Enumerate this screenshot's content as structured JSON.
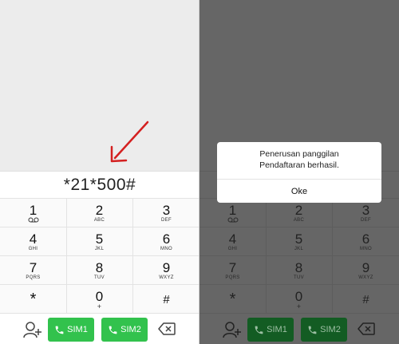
{
  "left": {
    "dialed_number": "*21*500#",
    "keypad": [
      [
        {
          "digit": "1",
          "letters": "○○"
        },
        {
          "digit": "2",
          "letters": "ABC"
        },
        {
          "digit": "3",
          "letters": "DEF"
        }
      ],
      [
        {
          "digit": "4",
          "letters": "GHI"
        },
        {
          "digit": "5",
          "letters": "JKL"
        },
        {
          "digit": "6",
          "letters": "MNO"
        }
      ],
      [
        {
          "digit": "7",
          "letters": "PQRS"
        },
        {
          "digit": "8",
          "letters": "TUV"
        },
        {
          "digit": "9",
          "letters": "WXYZ"
        }
      ],
      [
        {
          "digit": "*",
          "letters": ""
        },
        {
          "digit": "0",
          "letters": "+"
        },
        {
          "digit": "#",
          "letters": ""
        }
      ]
    ],
    "sim1_label": "SIM1",
    "sim2_label": "SIM2"
  },
  "right": {
    "dialed_number": "",
    "dialog": {
      "line1": "Penerusan panggilan",
      "line2": "Pendaftaran berhasil.",
      "ok_label": "Oke"
    },
    "keypad": [
      [
        {
          "digit": "1",
          "letters": "○○"
        },
        {
          "digit": "2",
          "letters": "ABC"
        },
        {
          "digit": "3",
          "letters": "DEF"
        }
      ],
      [
        {
          "digit": "4",
          "letters": "GHI"
        },
        {
          "digit": "5",
          "letters": "JKL"
        },
        {
          "digit": "6",
          "letters": "MNO"
        }
      ],
      [
        {
          "digit": "7",
          "letters": "PQRS"
        },
        {
          "digit": "8",
          "letters": "TUV"
        },
        {
          "digit": "9",
          "letters": "WXYZ"
        }
      ],
      [
        {
          "digit": "*",
          "letters": ""
        },
        {
          "digit": "0",
          "letters": "+"
        },
        {
          "digit": "#",
          "letters": ""
        }
      ]
    ],
    "sim1_label": "SIM1",
    "sim2_label": "SIM2"
  },
  "icons": {
    "contact": "add-contact-icon",
    "call": "phone-icon",
    "backspace": "backspace-icon",
    "annotation": "red-arrow-icon",
    "voicemail": "voicemail-icon"
  },
  "colors": {
    "sim_green": "#32c24d",
    "sim_green_dimmed": "#135c23",
    "overlay": "#666666",
    "arrow_red": "#d42020"
  }
}
